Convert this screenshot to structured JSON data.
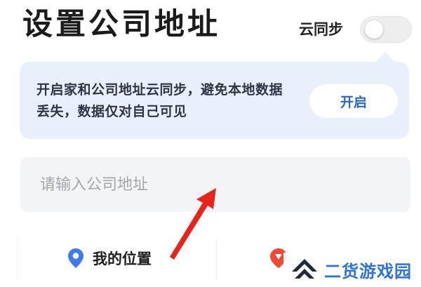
{
  "header": {
    "title": "设置公司地址",
    "sync_label": "云同步",
    "sync_enabled": false
  },
  "banner": {
    "text": "开启家和公司地址云同步，避免本地数据丢失，数据仅对自己可见",
    "button_label": "开启"
  },
  "address_input": {
    "placeholder": "请输入公司地址",
    "value": ""
  },
  "bottom_actions": {
    "my_location_label": "我的位置",
    "map_select_label": ""
  },
  "watermark": {
    "text": "二货游戏园"
  },
  "icons": {
    "location": "location-pin-icon",
    "map_select": "map-pin-icon",
    "watermark_logo": "chevron-up-logo-icon",
    "annotation": "red-arrow"
  },
  "colors": {
    "accent_blue": "#2a65d9",
    "banner_bg": "#eaf0fb",
    "input_bg": "#f3f4f7",
    "pin_blue": "#3f7bec",
    "pin_red": "#ef4a33",
    "arrow_red": "#e8231a",
    "watermark_blue": "#2d73d9"
  }
}
